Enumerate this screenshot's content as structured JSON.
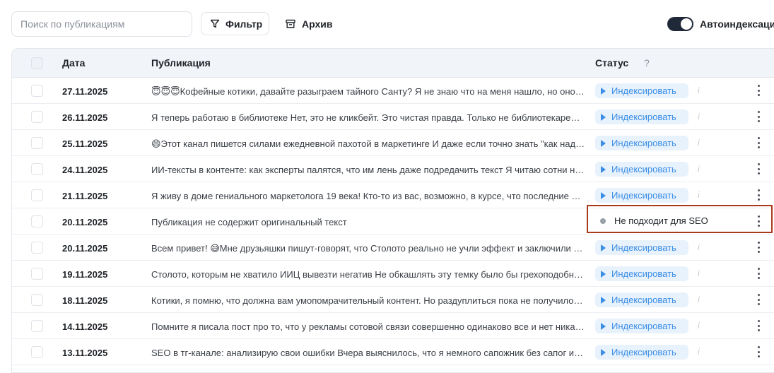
{
  "toolbar": {
    "search_placeholder": "Поиск по публикациям",
    "filter_label": "Фильтр",
    "archive_label": "Архив",
    "autoindex_label": "Автоиндексаци",
    "autoindex_on": true
  },
  "table": {
    "columns": {
      "date": "Дата",
      "publication": "Публикация",
      "status": "Статус",
      "help": "?"
    },
    "rows": [
      {
        "date": "27.11.2025",
        "text": "😇😇😇Кофейные котики, давайте разыграем тайного Санту? Я не знаю что на меня нашло, но оно пр...",
        "status": "Индексировать"
      },
      {
        "date": "26.11.2025",
        "text": "Я теперь работаю в библиотеке Нет, это не кликбейт. Это чистая правда. Только не библиотекарем. ...",
        "status": "Индексировать"
      },
      {
        "date": "25.11.2025",
        "text": "😄Этот канал пишется силами ежедневной пахотой в маркетинге И даже если точно знать \"как надо\"...",
        "status": "Индексировать"
      },
      {
        "date": "24.11.2025",
        "text": "ИИ-тексты в контенте: как эксперты палятся, что им лень даже подредачить текст Я читаю сотни но...",
        "status": "Индексировать"
      },
      {
        "date": "21.11.2025",
        "text": "Я живу в доме гениального маркетолога 19 века! Кто-то из вас, возможно, в курсе, что последние по...",
        "status": "Индексировать"
      },
      {
        "date": "20.11.2025",
        "text": "Публикация не содержит оригинальный текст",
        "status": "Не подходит для SEO",
        "non_seo": true
      },
      {
        "date": "20.11.2025",
        "text": "Всем привет! 😅Мне друзьяшки пишут-говорят, что Столото реально не учли эффект и заключили ко...",
        "status": "Индексировать"
      },
      {
        "date": "19.11.2025",
        "text": "Столото, которым не хватило ИИЦ вывезти негатив Не обкашлять эту темку было бы грехоподобным...",
        "status": "Индексировать"
      },
      {
        "date": "18.11.2025",
        "text": "Котики, я помню, что должна вам умопомрачительный контент. Но раздуплиться пока не получилос...",
        "status": "Индексировать"
      },
      {
        "date": "14.11.2025",
        "text": "Помните я писала пост про то, что у рекламы сотовой связи совершенно одинаково все и нет никак...",
        "status": "Индексировать"
      },
      {
        "date": "13.11.2025",
        "text": "SEO в тг-канале: анализирую свои ошибки Вчера выяснилось, что я немного сапожник без сапог ил...",
        "status": "Индексировать"
      }
    ],
    "info_glyph": "i"
  },
  "colors": {
    "accent": "#3b8ee6",
    "pill_bg": "#e8f2fc",
    "highlight": "#a93a1c",
    "toggle": "#1f2937"
  }
}
